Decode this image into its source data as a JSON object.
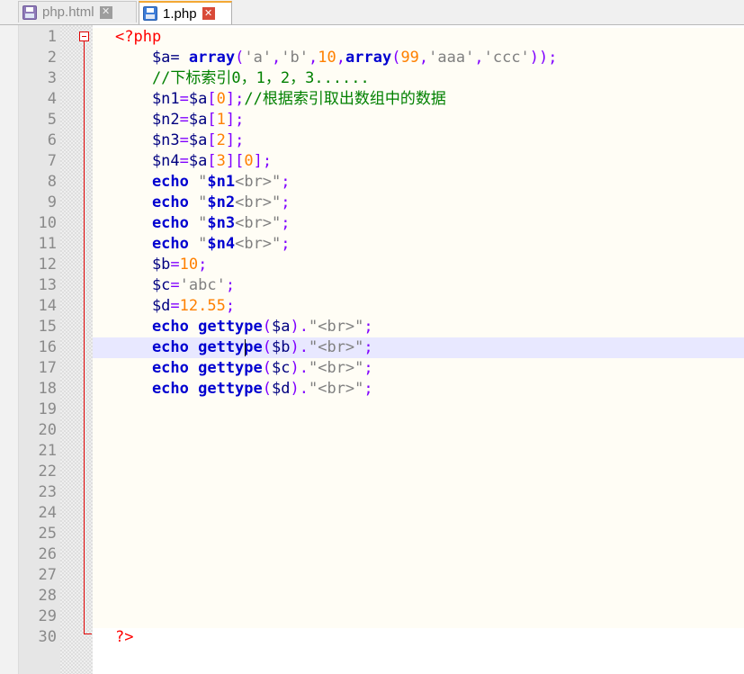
{
  "tabs": [
    {
      "label": "php.html",
      "active": false,
      "icon": "save-disk-icon",
      "close": "✕"
    },
    {
      "label": "1.php",
      "active": true,
      "icon": "save-disk-icon",
      "close": "✕"
    }
  ],
  "line_numbers": [
    "1",
    "2",
    "3",
    "4",
    "5",
    "6",
    "7",
    "8",
    "9",
    "10",
    "11",
    "12",
    "13",
    "14",
    "15",
    "16",
    "17",
    "18",
    "19",
    "20",
    "21",
    "22",
    "23",
    "24",
    "25",
    "26",
    "27",
    "28",
    "29",
    "30"
  ],
  "code_lines": [
    [
      {
        "t": "<?php",
        "c": "tag"
      }
    ],
    [
      {
        "t": "    $a= ",
        "c": "var"
      },
      {
        "t": "array",
        "c": "kw"
      },
      {
        "t": "(",
        "c": "op"
      },
      {
        "t": "'a'",
        "c": "str"
      },
      {
        "t": ",",
        "c": "op"
      },
      {
        "t": "'b'",
        "c": "str"
      },
      {
        "t": ",",
        "c": "op"
      },
      {
        "t": "10",
        "c": "num"
      },
      {
        "t": ",",
        "c": "op"
      },
      {
        "t": "array",
        "c": "kw"
      },
      {
        "t": "(",
        "c": "op"
      },
      {
        "t": "99",
        "c": "num"
      },
      {
        "t": ",",
        "c": "op"
      },
      {
        "t": "'aaa'",
        "c": "str"
      },
      {
        "t": ",",
        "c": "op"
      },
      {
        "t": "'ccc'",
        "c": "str"
      },
      {
        "t": "));",
        "c": "op"
      }
    ],
    [
      {
        "t": "    //下标索引0，1，2，3......",
        "c": "cmt"
      }
    ],
    [
      {
        "t": "    $n1",
        "c": "var"
      },
      {
        "t": "=",
        "c": "op"
      },
      {
        "t": "$a",
        "c": "var"
      },
      {
        "t": "[",
        "c": "op"
      },
      {
        "t": "0",
        "c": "num"
      },
      {
        "t": "];",
        "c": "op"
      },
      {
        "t": "//根据索引取出数组中的数据",
        "c": "cmt"
      }
    ],
    [
      {
        "t": "    $n2",
        "c": "var"
      },
      {
        "t": "=",
        "c": "op"
      },
      {
        "t": "$a",
        "c": "var"
      },
      {
        "t": "[",
        "c": "op"
      },
      {
        "t": "1",
        "c": "num"
      },
      {
        "t": "];",
        "c": "op"
      }
    ],
    [
      {
        "t": "    $n3",
        "c": "var"
      },
      {
        "t": "=",
        "c": "op"
      },
      {
        "t": "$a",
        "c": "var"
      },
      {
        "t": "[",
        "c": "op"
      },
      {
        "t": "2",
        "c": "num"
      },
      {
        "t": "];",
        "c": "op"
      }
    ],
    [
      {
        "t": "    $n4",
        "c": "var"
      },
      {
        "t": "=",
        "c": "op"
      },
      {
        "t": "$a",
        "c": "var"
      },
      {
        "t": "[",
        "c": "op"
      },
      {
        "t": "3",
        "c": "num"
      },
      {
        "t": "][",
        "c": "op"
      },
      {
        "t": "0",
        "c": "num"
      },
      {
        "t": "];",
        "c": "op"
      }
    ],
    [
      {
        "t": "    echo ",
        "c": "kw"
      },
      {
        "t": "\"",
        "c": "str"
      },
      {
        "t": "$n1",
        "c": "kw"
      },
      {
        "t": "<br>\"",
        "c": "str"
      },
      {
        "t": ";",
        "c": "op"
      }
    ],
    [
      {
        "t": "    echo ",
        "c": "kw"
      },
      {
        "t": "\"",
        "c": "str"
      },
      {
        "t": "$n2",
        "c": "kw"
      },
      {
        "t": "<br>\"",
        "c": "str"
      },
      {
        "t": ";",
        "c": "op"
      }
    ],
    [
      {
        "t": "    echo ",
        "c": "kw"
      },
      {
        "t": "\"",
        "c": "str"
      },
      {
        "t": "$n3",
        "c": "kw"
      },
      {
        "t": "<br>\"",
        "c": "str"
      },
      {
        "t": ";",
        "c": "op"
      }
    ],
    [
      {
        "t": "    echo ",
        "c": "kw"
      },
      {
        "t": "\"",
        "c": "str"
      },
      {
        "t": "$n4",
        "c": "kw"
      },
      {
        "t": "<br>\"",
        "c": "str"
      },
      {
        "t": ";",
        "c": "op"
      }
    ],
    [
      {
        "t": "    $b",
        "c": "var"
      },
      {
        "t": "=",
        "c": "op"
      },
      {
        "t": "10",
        "c": "num"
      },
      {
        "t": ";",
        "c": "op"
      }
    ],
    [
      {
        "t": "    $c",
        "c": "var"
      },
      {
        "t": "=",
        "c": "op"
      },
      {
        "t": "'abc'",
        "c": "str"
      },
      {
        "t": ";",
        "c": "op"
      }
    ],
    [
      {
        "t": "    $d",
        "c": "var"
      },
      {
        "t": "=",
        "c": "op"
      },
      {
        "t": "12.55",
        "c": "num"
      },
      {
        "t": ";",
        "c": "op"
      }
    ],
    [
      {
        "t": "    echo gettype",
        "c": "kw"
      },
      {
        "t": "(",
        "c": "op"
      },
      {
        "t": "$a",
        "c": "var"
      },
      {
        "t": ").",
        "c": "op"
      },
      {
        "t": "\"<br>\"",
        "c": "str"
      },
      {
        "t": ";",
        "c": "op"
      }
    ],
    [
      {
        "t": "    echo gettype",
        "c": "kw"
      },
      {
        "t": "(",
        "c": "op"
      },
      {
        "t": "$b",
        "c": "var"
      },
      {
        "t": ").",
        "c": "op"
      },
      {
        "t": "\"<br>\"",
        "c": "str"
      },
      {
        "t": ";",
        "c": "op"
      }
    ],
    [
      {
        "t": "    echo gettype",
        "c": "kw"
      },
      {
        "t": "(",
        "c": "op"
      },
      {
        "t": "$c",
        "c": "var"
      },
      {
        "t": ").",
        "c": "op"
      },
      {
        "t": "\"<br>\"",
        "c": "str"
      },
      {
        "t": ";",
        "c": "op"
      }
    ],
    [
      {
        "t": "    echo gettype",
        "c": "kw"
      },
      {
        "t": "(",
        "c": "op"
      },
      {
        "t": "$d",
        "c": "var"
      },
      {
        "t": ").",
        "c": "op"
      },
      {
        "t": "\"<br>\"",
        "c": "str"
      },
      {
        "t": ";",
        "c": "op"
      }
    ],
    [],
    [],
    [],
    [],
    [],
    [],
    [],
    [],
    [],
    [],
    [],
    [
      {
        "t": "?>",
        "c": "tag"
      }
    ]
  ],
  "current_line": "16",
  "colors": {
    "keyword": "#0000d0",
    "variable": "#000080",
    "operator": "#8000ff",
    "string": "#808080",
    "number": "#ff8000",
    "comment": "#008000",
    "php_tag": "#ff0000",
    "current_line_bg": "#e8e8ff"
  }
}
